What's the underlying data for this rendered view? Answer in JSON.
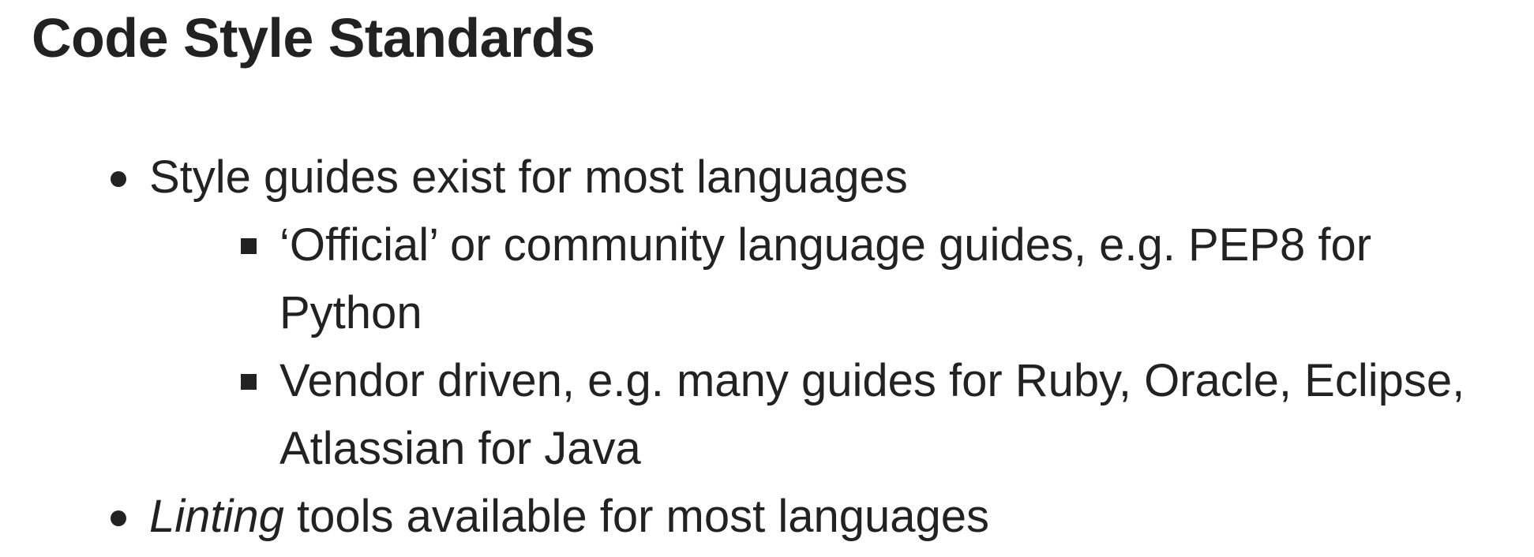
{
  "slide": {
    "title": "Code Style Standards",
    "items": [
      {
        "text": "Style guides exist for most languages",
        "subitems": [
          {
            "text": "‘Official’ or community language guides, e.g. PEP8 for Python"
          },
          {
            "text": "Vendor driven, e.g. many guides for Ruby, Oracle, Eclipse, Atlassian for Java"
          }
        ]
      },
      {
        "emphasis": "Linting",
        "text": " tools available for most languages"
      }
    ]
  }
}
